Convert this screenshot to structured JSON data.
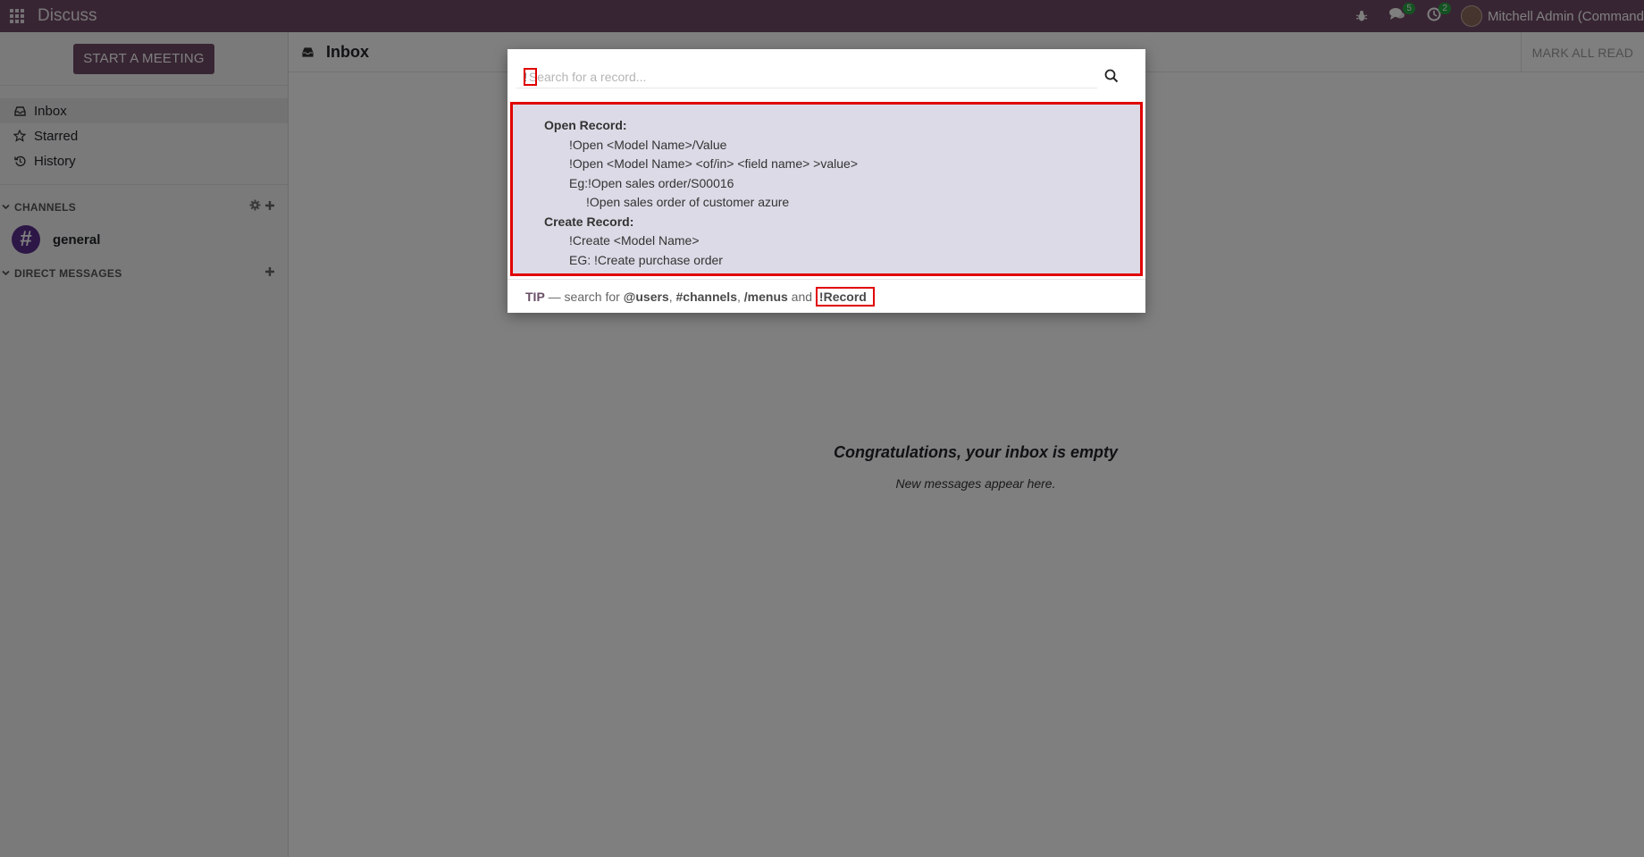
{
  "navbar": {
    "app_name": "Discuss",
    "messages_badge": "5",
    "activities_badge": "2",
    "user_name": "Mitchell Admin (Command"
  },
  "sidebar": {
    "start_meeting": "START A MEETING",
    "mailboxes": [
      {
        "label": "Inbox",
        "icon": "inbox-icon",
        "active": true
      },
      {
        "label": "Starred",
        "icon": "star-icon",
        "active": false
      },
      {
        "label": "History",
        "icon": "history-icon",
        "active": false
      }
    ],
    "channels_header": "CHANNELS",
    "channels": [
      {
        "symbol": "#",
        "name": "general"
      }
    ],
    "dm_header": "DIRECT MESSAGES"
  },
  "main": {
    "title": "Inbox",
    "mark_all_read": "MARK ALL READ",
    "empty_title": "Congratulations, your inbox is empty",
    "empty_subtitle": "New messages appear here."
  },
  "command_palette": {
    "search_value": "!",
    "search_placeholder": "Search for a record...",
    "help": {
      "open_header": "Open Record:",
      "open_line1": "!Open <Model Name>/Value",
      "open_line2": "!Open <Model Name> <of/in> <field name> >value>",
      "open_line3": "Eg:!Open sales order/S00016",
      "open_line4": "!Open sales order of customer azure",
      "create_header": "Create Record:",
      "create_line1": "!Create <Model Name>",
      "create_line2": "EG: !Create purchase order"
    },
    "tip": {
      "label": "TIP",
      "text1": " — search for ",
      "users": "@users",
      "sep1": ", ",
      "channels": "#channels",
      "sep2": ", ",
      "menus": "/menus",
      "and": " and ",
      "record": "!Record"
    }
  },
  "colors": {
    "brand": "#714B67",
    "highlight": "#e00000",
    "help_bg": "#dcdae6",
    "badge": "#28a745"
  }
}
